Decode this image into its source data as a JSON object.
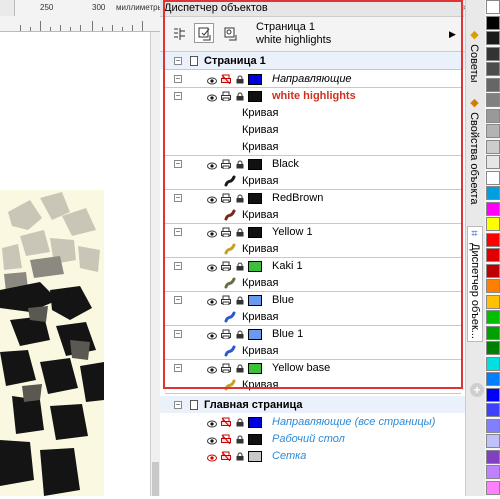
{
  "ruler": {
    "n250": "250",
    "n300": "300",
    "unit": "миллиметры"
  },
  "docker": {
    "title": "Диспетчер объектов",
    "page_name": "Страница 1",
    "layer_name": "white highlights",
    "close": "»"
  },
  "tree": {
    "page1_title": "Страница 1",
    "layers": [
      {
        "name": "Направляющие",
        "color": "#0000e0",
        "italic": true,
        "expanded": false
      },
      {
        "name": "white highlights",
        "color": "#111111",
        "active": true,
        "expanded": true,
        "children": [
          "Кривая",
          "Кривая",
          "Кривая"
        ]
      },
      {
        "name": "Black",
        "color": "#111111",
        "children": [
          "Кривая"
        ],
        "curve_color": "#1a1a1a"
      },
      {
        "name": "RedBrown",
        "color": "#111111",
        "children": [
          "Кривая"
        ],
        "curve_color": "#7a2a1a"
      },
      {
        "name": "Yellow 1",
        "color": "#111111",
        "children": [
          "Кривая"
        ],
        "curve_color": "#c8a020"
      },
      {
        "name": "Kaki 1",
        "color": "#3cc03c",
        "children": [
          "Кривая"
        ],
        "curve_color": "#6b6b40"
      },
      {
        "name": "Blue",
        "color": "#6a9af0",
        "children": [
          "Кривая"
        ],
        "curve_color": "#2a5ad0"
      },
      {
        "name": "Blue 1",
        "color": "#6a9af0",
        "children": [
          "Кривая"
        ],
        "curve_color": "#2a5ad0"
      },
      {
        "name": "Yellow base",
        "color": "#3cc03c",
        "children": [
          "Кривая"
        ],
        "curve_color": "#c8a020"
      }
    ],
    "master_title": "Главная страница",
    "master_layers": [
      {
        "name": "Направляющие (все страницы)",
        "color": "#0000e0"
      },
      {
        "name": "Рабочий стол",
        "color": "#111111"
      },
      {
        "name": "Сетка",
        "color": "#c8c8c8"
      }
    ],
    "curve_label": "Кривая"
  },
  "side_tabs": {
    "tips": "Советы",
    "props": "Свойства объекта",
    "manager": "Диспетчер объек..."
  },
  "colors": {
    "accent_red": "#e03434",
    "active_layer_text": "#d03020",
    "master_text": "#2a8ad8"
  },
  "palette": [
    "#ffffff",
    "#000000",
    "#1a1a1a",
    "#333333",
    "#4d4d4d",
    "#666666",
    "#808080",
    "#999999",
    "#b3b3b3",
    "#cccccc",
    "#e6e6e6",
    "#ffffff",
    "#00a0e0",
    "#ff00ff",
    "#ffff00",
    "#ff0000",
    "#e00000",
    "#c00000",
    "#ff8000",
    "#ffc000",
    "#00c000",
    "#00a000",
    "#008000",
    "#00e0e0",
    "#0080ff",
    "#0000ff",
    "#4040ff",
    "#8080ff",
    "#c0c0ff",
    "#8040c0",
    "#c080ff",
    "#ff80ff"
  ]
}
